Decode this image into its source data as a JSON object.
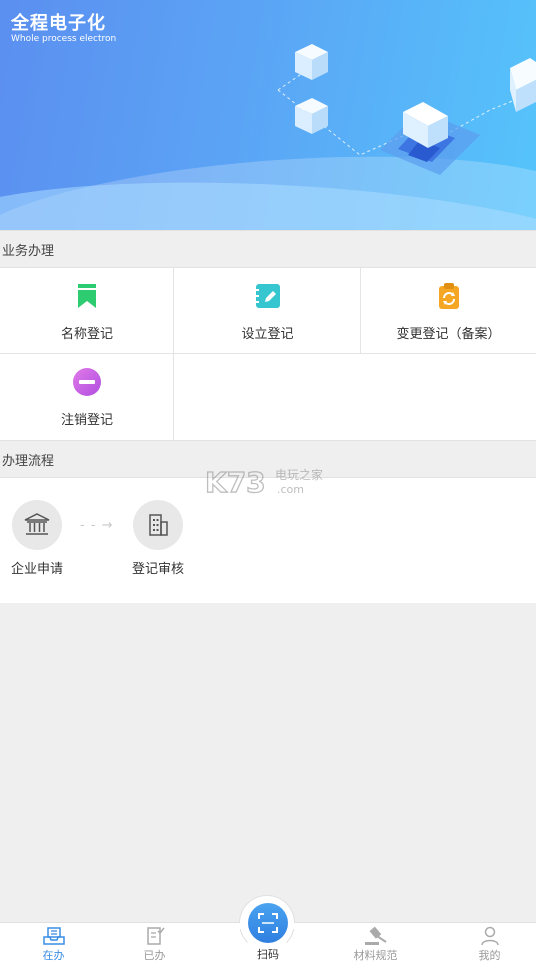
{
  "banner": {
    "title": "全程电子化",
    "subtitle": "Whole process electron"
  },
  "business": {
    "heading": "业务办理",
    "items": [
      {
        "label": "名称登记",
        "icon": "bookmark-icon",
        "color": "#2ecc71"
      },
      {
        "label": "设立登记",
        "icon": "notebook-edit-icon",
        "color": "#35c6d0"
      },
      {
        "label": "变更登记（备案）",
        "icon": "clipboard-refresh-icon",
        "color": "#f5a623"
      },
      {
        "label": "注销登记",
        "icon": "minus-circle-icon",
        "color": "#c65ae6"
      }
    ]
  },
  "process": {
    "heading": "办理流程",
    "steps": [
      {
        "label": "企业申请",
        "icon": "bank-icon"
      },
      {
        "label": "登记审核",
        "icon": "building-icon"
      }
    ],
    "arrow": "- - →"
  },
  "watermark": {
    "brand": "K73",
    "line1": "电玩之家",
    "line2": ".com"
  },
  "tabbar": {
    "tabs": [
      {
        "label": "在办",
        "icon": "inbox-tray-icon",
        "active": true
      },
      {
        "label": "已办",
        "icon": "checked-document-icon",
        "active": false
      },
      {
        "label": "扫码",
        "icon": "scan-icon",
        "active": false
      },
      {
        "label": "材料规范",
        "icon": "gavel-icon",
        "active": false
      },
      {
        "label": "我的",
        "icon": "user-icon",
        "active": false
      }
    ]
  },
  "colors": {
    "accent": "#3a8ee6",
    "banner_start": "#5b8ff0",
    "banner_end": "#55c4fb"
  }
}
